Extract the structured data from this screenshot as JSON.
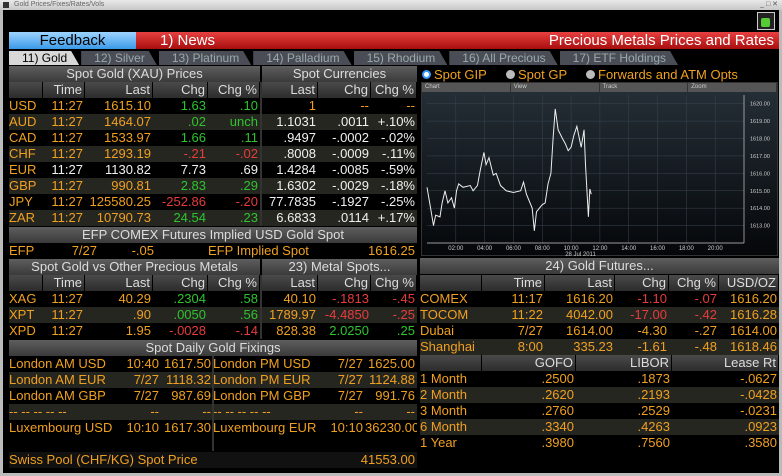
{
  "window": {
    "title": "Gold Prices/Fixes/Rates/Vols"
  },
  "topbar": {
    "feedback": "Feedback",
    "news": "1) News",
    "title": "Precious Metals Prices and Rates"
  },
  "tabs": [
    "11) Gold",
    "12)  Silver",
    "13)  Platinum",
    "14) Palladium",
    "15) Rhodium",
    "16) All Precious",
    "17) ETF Holdings"
  ],
  "spot_gold": {
    "title": "Spot Gold (XAU) Prices",
    "currencies_title": "Spot Currencies",
    "columns": [
      "",
      "Time",
      "Last",
      "Chg",
      "Chg %",
      "Last",
      "Chg",
      "Chg %"
    ],
    "rows": [
      {
        "cells": [
          "USD",
          "11:27",
          "1615.10",
          "1.63",
          ".10",
          "1",
          "--",
          "--"
        ],
        "colors": [
          "o",
          "o",
          "o",
          "g",
          "g",
          "o",
          "o",
          "o"
        ]
      },
      {
        "cells": [
          "AUD",
          "11:27",
          "1464.07",
          ".02",
          "unch",
          "1.1031",
          ".0011",
          "+.10%"
        ],
        "colors": [
          "o",
          "o",
          "o",
          "g",
          "g",
          "w",
          "w",
          "w"
        ]
      },
      {
        "cells": [
          "CAD",
          "11:27",
          "1533.97",
          "1.66",
          ".11",
          ".9497",
          "-.0002",
          "-.02%"
        ],
        "colors": [
          "o",
          "o",
          "o",
          "g",
          "g",
          "w",
          "w",
          "w"
        ]
      },
      {
        "cells": [
          "CHF",
          "11:27",
          "1293.19",
          "-.21",
          "-.02",
          ".8008",
          "-.0009",
          "-.11%"
        ],
        "colors": [
          "o",
          "o",
          "o",
          "rd",
          "rd",
          "w",
          "w",
          "w"
        ]
      },
      {
        "cells": [
          "EUR",
          "11:27",
          "1130.82",
          "7.73",
          ".69",
          "1.4284",
          "-.0085",
          "-.59%"
        ],
        "colors": [
          "o",
          "w",
          "w",
          "w",
          "w",
          "w",
          "w",
          "w"
        ]
      },
      {
        "cells": [
          "GBP",
          "11:27",
          "990.81",
          "2.83",
          ".29",
          "1.6302",
          "-.0029",
          "-.18%"
        ],
        "colors": [
          "o",
          "o",
          "o",
          "g",
          "g",
          "w",
          "w",
          "w"
        ]
      },
      {
        "cells": [
          "JPY",
          "11:27",
          "125580.25",
          "-252.86",
          "-.20",
          "77.7835",
          "-.1927",
          "-.25%"
        ],
        "colors": [
          "o",
          "o",
          "o",
          "rd",
          "rd",
          "w",
          "w",
          "w"
        ]
      },
      {
        "cells": [
          "ZAR",
          "11:27",
          "10790.73",
          "24.54",
          ".23",
          "6.6833",
          ".0114",
          "+.17%"
        ],
        "colors": [
          "o",
          "o",
          "o",
          "g",
          "g",
          "w",
          "w",
          "w"
        ]
      }
    ]
  },
  "efp": {
    "title": "EFP COMEX Futures Implied USD Gold Spot",
    "label": "EFP",
    "time": "7/27",
    "chg": "-.05",
    "implied_label": "EFP Implied Spot",
    "implied_value": "1616.25"
  },
  "metals": {
    "title": "Spot Gold vs Other Precious Metals",
    "spots_title": "23) Metal Spots...",
    "columns": [
      "",
      "Time",
      "Last",
      "Chg",
      "Chg %",
      "Last",
      "Chg",
      "Chg %"
    ],
    "rows": [
      {
        "cells": [
          "XAG",
          "11:27",
          "40.29",
          ".2304",
          ".58",
          "40.10",
          "-.1813",
          "-.45"
        ],
        "colors": [
          "o",
          "o",
          "o",
          "g",
          "g",
          "o",
          "rd",
          "rd"
        ]
      },
      {
        "cells": [
          "XPT",
          "11:27",
          ".90",
          ".0050",
          ".56",
          "1789.97",
          "-4.4850",
          "-.25"
        ],
        "colors": [
          "o",
          "o",
          "o",
          "g",
          "g",
          "o",
          "rd",
          "rd"
        ]
      },
      {
        "cells": [
          "XPD",
          "11:27",
          "1.95",
          "-.0028",
          "-.14",
          "828.38",
          "2.0250",
          ".25"
        ],
        "colors": [
          "o",
          "o",
          "o",
          "rd",
          "rd",
          "o",
          "g",
          "g"
        ]
      }
    ]
  },
  "fixings": {
    "title": "Spot Daily Gold Fixings",
    "rows": [
      [
        "London AM USD",
        "10:40",
        "1617.50",
        "London PM USD",
        "7/27",
        "1625.00"
      ],
      [
        "London AM EUR",
        "7/27",
        "1118.32",
        "London PM EUR",
        "7/27",
        "1124.88"
      ],
      [
        "London AM GBP",
        "7/27",
        "987.69",
        "London PM GBP",
        "7/27",
        "991.76"
      ],
      [
        "--  --  --  --  --",
        "--",
        "--",
        "--  --  --  --  --",
        "--",
        "--"
      ],
      [
        "Luxembourg USD",
        "10:10",
        "1617.30",
        "Luxembourg EUR",
        "10:10",
        "36230.00"
      ]
    ],
    "swiss_label": "Swiss Pool (CHF/KG) Spot Price",
    "swiss_value": "41553.00"
  },
  "chart": {
    "radios": [
      {
        "label": "Spot GIP",
        "selected": true
      },
      {
        "label": "Spot GP",
        "selected": false
      },
      {
        "label": "Forwards and ATM Opts",
        "selected": false
      }
    ],
    "toolbar": [
      "Chart",
      "View",
      "Track",
      "Zoom"
    ]
  },
  "chart_data": {
    "type": "line",
    "xlabel": "28 Jul 2011",
    "x_ticks": [
      "02:00",
      "04:00",
      "06:00",
      "08:00",
      "10:00",
      "12:00",
      "14:00",
      "16:00",
      "18:00",
      "20:00"
    ],
    "y_ticks": [
      "1613.00",
      "1614.00",
      "1615.00",
      "1616.00",
      "1617.00",
      "1618.00",
      "1619.00",
      "1620.00"
    ],
    "xlim_hours": [
      0,
      22
    ],
    "ylim": [
      1612,
      1620.5
    ],
    "grid": true,
    "series": [
      {
        "x": [
          0,
          0.25,
          0.45,
          0.6,
          0.9,
          1.05,
          1.25,
          1.45,
          1.7,
          1.9,
          2.05,
          2.2,
          2.5,
          3.0,
          3.2,
          3.5,
          3.7,
          3.95,
          4.1,
          4.3,
          4.6,
          4.8,
          5.1,
          5.5,
          6.0,
          6.5,
          6.7,
          6.9,
          7.3,
          7.45,
          7.6,
          8.0,
          8.2,
          8.4,
          8.6,
          8.75,
          8.9,
          9.1,
          9.4,
          9.6,
          9.8,
          10.0,
          10.2,
          10.4,
          10.7,
          10.9,
          11.0,
          11.1,
          11.2,
          11.3,
          11.4
        ],
        "y": [
          1615.2,
          1614.0,
          1613.0,
          1613.6,
          1613.5,
          1614.3,
          1615.0,
          1614.3,
          1614.6,
          1614.0,
          1615.0,
          1615.4,
          1615.2,
          1615.3,
          1615.0,
          1615.3,
          1616.2,
          1617.2,
          1616.5,
          1616.9,
          1615.9,
          1616.0,
          1615.3,
          1615.0,
          1614.9,
          1615.0,
          1615.5,
          1614.8,
          1614.0,
          1612.7,
          1613.8,
          1614.2,
          1614.3,
          1615.4,
          1616.0,
          1618.0,
          1619.7,
          1618.5,
          1618.0,
          1617.7,
          1617.3,
          1617.5,
          1618.2,
          1618.7,
          1617.5,
          1618.5,
          1616.5,
          1615.0,
          1613.5,
          1615.1,
          1614.8
        ]
      }
    ]
  },
  "futures": {
    "title": "24) Gold Futures...",
    "columns": [
      "",
      "Time",
      "Last",
      "Chg",
      "Chg %",
      "USD/OZ"
    ],
    "rows": [
      {
        "cells": [
          "COMEX",
          "11:17",
          "1616.20",
          "-1.10",
          "-.07",
          "1616.20"
        ],
        "colors": [
          "o",
          "o",
          "o",
          "rd",
          "rd",
          "o"
        ]
      },
      {
        "cells": [
          "TOCOM",
          "11:22",
          "4042.00",
          "-17.00",
          "-.42",
          "1616.28"
        ],
        "colors": [
          "o",
          "o",
          "o",
          "rd",
          "rd",
          "o"
        ]
      },
      {
        "cells": [
          "Dubai",
          "7/27",
          "1614.00",
          "-4.30",
          "-.27",
          "1614.00"
        ],
        "colors": [
          "o",
          "o",
          "o",
          "o",
          "o",
          "o"
        ]
      },
      {
        "cells": [
          "Shanghai",
          "8:00",
          "335.23",
          "-1.61",
          "-.48",
          "1618.46"
        ],
        "colors": [
          "o",
          "o",
          "o",
          "o",
          "o",
          "o"
        ]
      }
    ]
  },
  "rates": {
    "columns": [
      "",
      "GOFO",
      "LIBOR",
      "Lease Rt"
    ],
    "rows": [
      [
        "1 Month",
        ".2500",
        ".1873",
        "-.0627"
      ],
      [
        "2 Month",
        ".2620",
        ".2193",
        "-.0428"
      ],
      [
        "3 Month",
        ".2760",
        ".2529",
        "-.0231"
      ],
      [
        "6 Month",
        ".3340",
        ".4263",
        ".0923"
      ],
      [
        "1 Year",
        ".3980",
        ".7560",
        ".3580"
      ]
    ]
  }
}
